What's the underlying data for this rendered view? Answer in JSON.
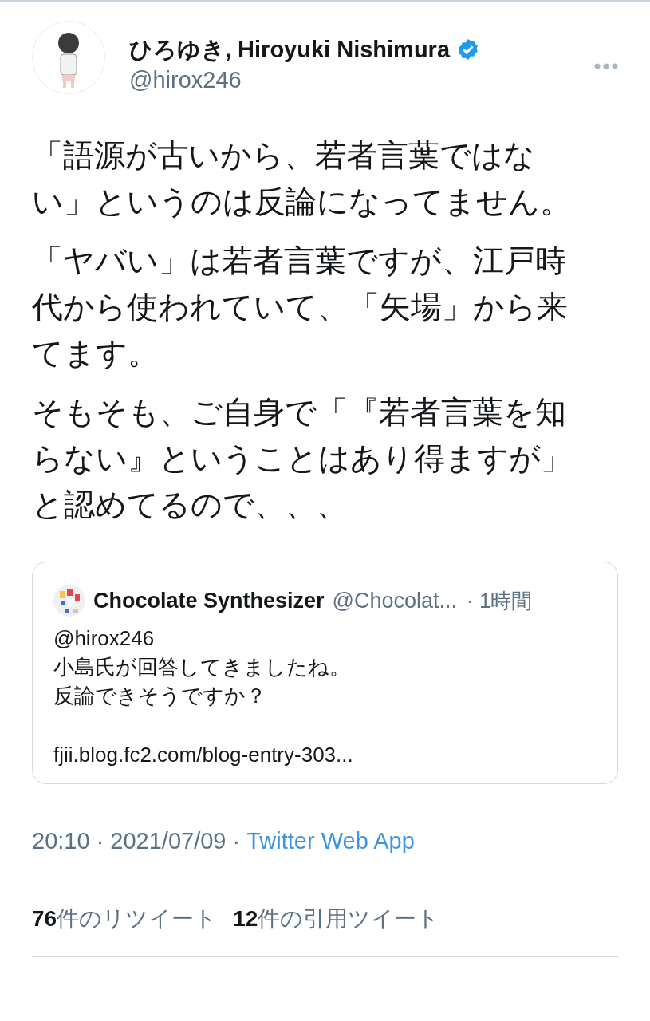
{
  "author": {
    "name": "ひろゆき, Hiroyuki Nishimura",
    "verified": true,
    "handle": "@hirox246"
  },
  "paragraphs": [
    "「語源が古いから、若者言葉ではない」というのは反論になってません。",
    "「ヤバい」は若者言葉ですが、江戸時代から使われていて、「矢場」から来てます。",
    "そもそも、ご自身で「『若者言葉を知らない』ということはあり得ますが」と認めてるので、、、"
  ],
  "quoted": {
    "name": "Chocolate Synthesizer",
    "handle": "@Chocolat...",
    "time": "· 1時間",
    "paragraphs": [
      [
        "@hirox246",
        "小島氏が回答してきましたね。",
        "反論できそうですか？"
      ],
      [
        "fjii.blog.fc2.com/blog-entry-303..."
      ]
    ]
  },
  "meta": {
    "time": "20:10 · 2021/07/09 ·",
    "source": "Twitter Web App"
  },
  "stats": [
    {
      "count": "76",
      "label": "件のリツイート"
    },
    {
      "count": "12",
      "label": "件の引用ツイート"
    }
  ]
}
